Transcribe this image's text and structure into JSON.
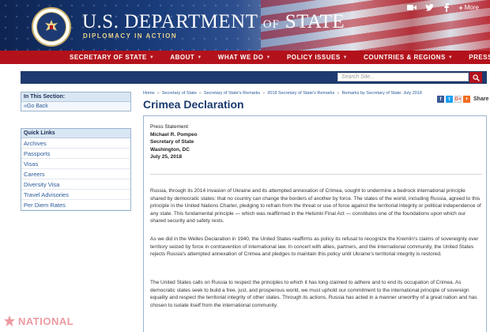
{
  "header": {
    "title_main": "U.S. DEPARTMENT",
    "title_of": "OF",
    "title_state": "STATE",
    "tagline": "DIPLOMACY IN ACTION",
    "more_label": "More",
    "icons": [
      "video-icon",
      "twitter-icon",
      "facebook-icon",
      "plus-icon"
    ]
  },
  "nav": {
    "items": [
      {
        "label": "SECRETARY OF STATE"
      },
      {
        "label": "ABOUT"
      },
      {
        "label": "WHAT WE DO"
      },
      {
        "label": "POLICY ISSUES"
      },
      {
        "label": "COUNTRIES & REGIONS"
      },
      {
        "label": "PRESS"
      }
    ]
  },
  "search": {
    "placeholder": "Search Site..."
  },
  "sidebar": {
    "section_title": "In This Section:",
    "go_back": "Go Back",
    "quick_title": "Quick Links",
    "quick_links": [
      "Archives",
      "Passports",
      "Visas",
      "Careers",
      "Diversity Visa",
      "Travel Advisories",
      "Per Diem Rates"
    ]
  },
  "breadcrumb": [
    "Home",
    "Secretary of State",
    "Secretary of State's Remarks",
    "2018 Secretary of State's Remarks",
    "Remarks by Secretary of State: July 2018"
  ],
  "share": {
    "label": "Share"
  },
  "article": {
    "title": "Crimea Declaration",
    "type": "Press Statement",
    "author": "Michael R. Pompeo",
    "author_title": "Secretary of State",
    "location": "Washington, DC",
    "date": "July 25, 2018",
    "paragraphs": [
      "Russia, through its 2014 invasion of Ukraine and its attempted annexation of Crimea, sought to undermine a bedrock international principle shared by democratic states: that no country can change the borders of another by force. The states of the world, including Russia, agreed to this principle in the United Nations Charter, pledging to refrain from the threat or use of force against the territorial integrity or political independence of any state. This fundamental principle — which was reaffirmed in the Helsinki Final Act — constitutes one of the foundations upon which our shared security and safety rests.",
      "As we did in the Welles Declaration in 1940, the United States reaffirms as policy its refusal to recognize the Kremlin's claims of sovereignty over territory seized by force in contravention of international law. In concert with allies, partners, and the international community, the United States rejects Russia's attempted annexation of Crimea and pledges to maintain this policy until Ukraine's territorial integrity is restored.",
      "The United States calls on Russia to respect the principles to which it has long claimed to adhere and to end its occupation of Crimea. As democratic states seek to build a free, just, and prosperous world, we must uphold our commitment to the international principle of sovereign equality and respect the territorial integrity of other states. Through its actions, Russia has acted in a manner unworthy of a great nation and has chosen to isolate itself from the international community."
    ]
  },
  "watermark": {
    "text": "NATIONAL"
  },
  "colors": {
    "nav_red": "#b3121b",
    "navy": "#1e3a6e",
    "link_blue": "#2a5a9a",
    "title_blue": "#1b3b6f"
  }
}
